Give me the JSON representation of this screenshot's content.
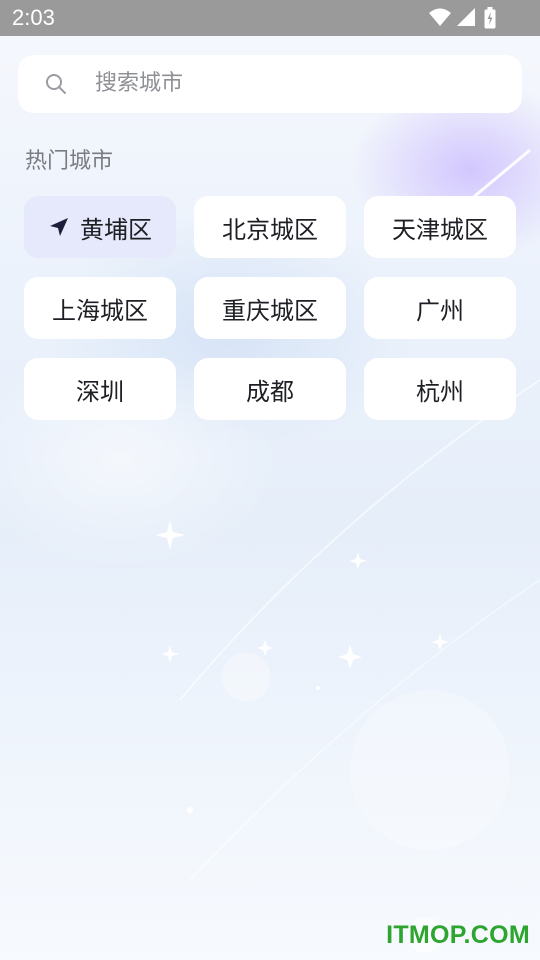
{
  "status_bar": {
    "time": "2:03"
  },
  "search": {
    "placeholder": "搜索城市"
  },
  "hot_cities": {
    "title": "热门城市",
    "current": "黄埔区",
    "cities": [
      "北京城区",
      "天津城区",
      "上海城区",
      "重庆城区",
      "广州",
      "深圳",
      "成都",
      "杭州"
    ]
  },
  "watermark": "ITMOP.COM"
}
